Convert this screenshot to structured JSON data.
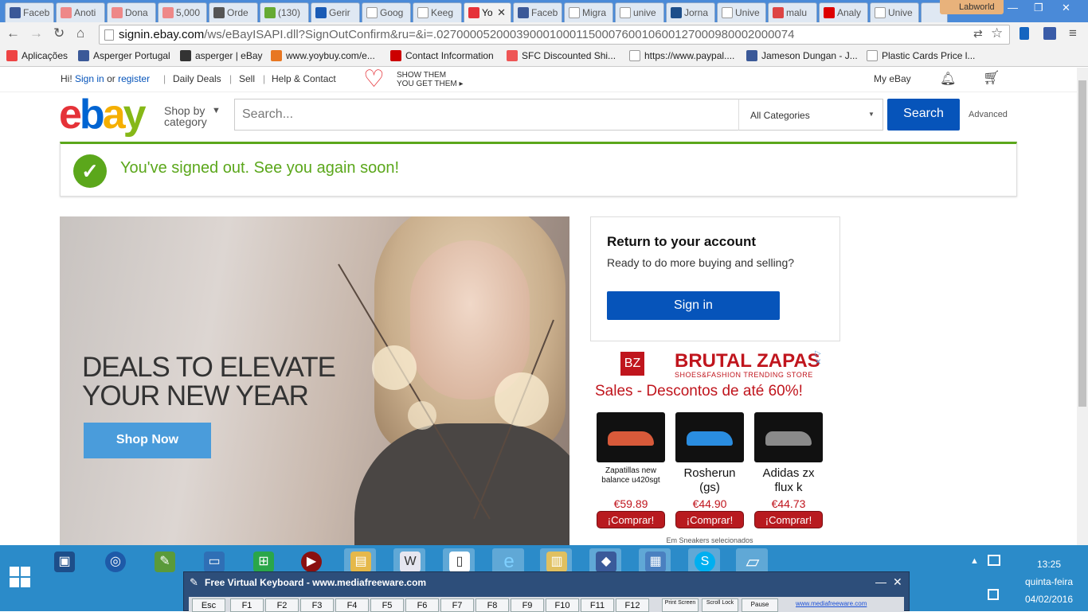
{
  "browser": {
    "tabs": [
      {
        "label": "Faceb",
        "icon": "facebook-icon"
      },
      {
        "label": "Anoti",
        "icon": "donation-icon"
      },
      {
        "label": "Dona",
        "icon": "donation-icon"
      },
      {
        "label": "5,000",
        "icon": "donation-icon"
      },
      {
        "label": "Orde",
        "icon": "order-icon"
      },
      {
        "label": "(130)",
        "icon": "leaf-icon"
      },
      {
        "label": "Gerir",
        "icon": "paypal-icon"
      },
      {
        "label": "Goog",
        "icon": "google-icon"
      },
      {
        "label": "Keeg",
        "icon": "page-icon"
      },
      {
        "label": "Yo",
        "icon": "ebay-icon",
        "active": true
      },
      {
        "label": "Faceb",
        "icon": "facebook-icon"
      },
      {
        "label": "Migra",
        "icon": "page-icon"
      },
      {
        "label": "unive",
        "icon": "page-icon"
      },
      {
        "label": "Jorna",
        "icon": "jn-icon"
      },
      {
        "label": "Unive",
        "icon": "page-icon"
      },
      {
        "label": "malu",
        "icon": "gmail-icon"
      },
      {
        "label": "Analy",
        "icon": "youtube-icon"
      },
      {
        "label": "Unive",
        "icon": "page-icon"
      }
    ],
    "profile": "Labworld",
    "url_host": "signin.ebay.com",
    "url_path": "/ws/eBayISAPI.dll?SignOutConfirm&ru=&i=.0270000520003900010001150007600106001270009800020​00074",
    "bookmarks": [
      {
        "label": "Aplicações",
        "color": "#e44"
      },
      {
        "label": "Asperger Portugal",
        "color": "#3b5998"
      },
      {
        "label": "asperger | eBay",
        "color": "#333"
      },
      {
        "label": "www.yoybuy.com/e...",
        "color": "#e87722"
      },
      {
        "label": "Contact Infcormation",
        "color": "#c00"
      },
      {
        "label": "SFC Discounted Shi...",
        "color": "#e55"
      },
      {
        "label": "https://www.paypal....",
        "color": "#fff"
      },
      {
        "label": "Jameson Dungan - J...",
        "color": "#3b5998"
      },
      {
        "label": "Plastic Cards Price l...",
        "color": "#fff"
      }
    ]
  },
  "ebay": {
    "greeting": "Hi!",
    "signin": "Sign in",
    "or": "or",
    "register": "register",
    "daily_deals": "Daily Deals",
    "sell": "Sell",
    "help": "Help & Contact",
    "promo_line1": "SHOW THEM",
    "promo_line2": "YOU GET THEM ▸",
    "my_ebay": "My eBay",
    "shop_by": "Shop by",
    "category": "category",
    "search_placeholder": "Search...",
    "all_categories": "All Categories",
    "search_button": "Search",
    "advanced": "Advanced",
    "notice": "You've signed out. See you again soon!",
    "hero_line1": "DEALS TO ELEVATE",
    "hero_line2": "YOUR NEW YEAR",
    "shop_now": "Shop Now",
    "account_title": "Return to your account",
    "account_sub": "Ready to do more buying and selling?",
    "account_signin": "Sign in",
    "colors": {
      "blue": "#0654ba",
      "green": "#5ba71b",
      "red": "#e53238",
      "yellow": "#f5af02",
      "lime": "#86b817"
    }
  },
  "ad": {
    "brand_icon": "BZ",
    "brand": "BRUTAL ZAPAS",
    "tagline": "SHOES&FASHION TRENDING STORE",
    "headline": "Sales - Descontos de até 60%!",
    "close": "▷ ✕",
    "products": [
      {
        "name": "Zapatillas new balance u420sgt",
        "price": "€59.89",
        "button": "¡Comprar!",
        "small": true,
        "shoe_color": "#d85a3a"
      },
      {
        "name": "Rosherun (gs)",
        "price": "€44.90",
        "button": "¡Comprar!",
        "small": false,
        "shoe_color": "#2a8de0"
      },
      {
        "name": "Adidas zx flux k",
        "price": "€44.73",
        "button": "¡Comprar!",
        "small": false,
        "shoe_color": "#8a8a8a"
      }
    ],
    "footer": "Em Sneakers selecionados"
  },
  "taskbar": {
    "time": "13:25",
    "day": "quinta-feira",
    "date": "04/02/2016"
  },
  "keyboard": {
    "title": "Free Virtual Keyboard - www.mediafreeware.com",
    "keys": [
      "Esc",
      "F1",
      "F2",
      "F3",
      "F4",
      "F5",
      "F6",
      "F7",
      "F8",
      "F9",
      "F10",
      "F11",
      "F12"
    ],
    "print": "Print Screen",
    "scroll": "Scroll Lock",
    "pause": "Pause",
    "link": "www.mediafreeware.com"
  }
}
